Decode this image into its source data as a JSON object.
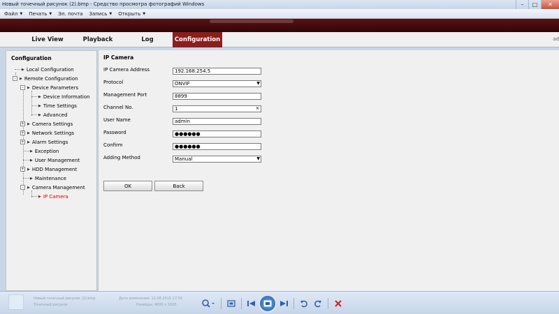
{
  "window": {
    "title": "Новый точечный рисунок (2).bmp - Средство просмотра фотографий Windows",
    "minimize_glyph": "–",
    "maximize_glyph": "□",
    "close_glyph": "✕"
  },
  "menu": {
    "items": [
      {
        "label": "Файл"
      },
      {
        "label": "Печать"
      },
      {
        "label": "Эл. почта"
      },
      {
        "label": "Запись"
      },
      {
        "label": "Открыть"
      }
    ]
  },
  "nav": {
    "tabs": [
      {
        "label": "Live View"
      },
      {
        "label": "Playback"
      },
      {
        "label": "Log"
      },
      {
        "label": "Configuration"
      }
    ],
    "active_tab": "Configuration",
    "user_label": "ad"
  },
  "sidebar": {
    "title": "Configuration",
    "items": [
      {
        "label": "Local Configuration",
        "expander": ""
      },
      {
        "label": "Remote Configuration",
        "expander": "–"
      },
      {
        "label": "Device Parameters",
        "expander": "–"
      },
      {
        "label": "Device Information",
        "expander": ""
      },
      {
        "label": "Time Settings",
        "expander": ""
      },
      {
        "label": "Advanced",
        "expander": ""
      },
      {
        "label": "Camera Settings",
        "expander": "+"
      },
      {
        "label": "Network Settings",
        "expander": "+"
      },
      {
        "label": "Alarm Settings",
        "expander": "+"
      },
      {
        "label": "Exception",
        "expander": ""
      },
      {
        "label": "User Management",
        "expander": ""
      },
      {
        "label": "HDD Management",
        "expander": "+"
      },
      {
        "label": "Maintenance",
        "expander": ""
      },
      {
        "label": "Camera Management",
        "expander": "–"
      },
      {
        "label": "IP Camera",
        "expander": "",
        "selected": true
      }
    ]
  },
  "form": {
    "title": "IP Camera",
    "fields": [
      {
        "label": "IP Camera Address",
        "value": "192.168.254.5"
      },
      {
        "label": "Protocol",
        "value": "ONVIF"
      },
      {
        "label": "Management Port",
        "value": "8899"
      },
      {
        "label": "Channel No.",
        "value": "1"
      },
      {
        "label": "User Name",
        "value": "admin"
      },
      {
        "label": "Password",
        "value": "●●●●●●"
      },
      {
        "label": "Confirm",
        "value": "●●●●●●"
      },
      {
        "label": "Adding Method",
        "value": "Manual"
      }
    ],
    "ok_label": "OK",
    "back_label": "Back"
  },
  "viewer": {
    "faded_name": "Новый точечный рисунок (2).bmp",
    "faded_type": "Точечный рисунок",
    "faded_date": "Дата изменения: 12.08.2015 17:50",
    "faded_size": "Размеры: 4000 x 1600",
    "icons": [
      "zoom-icon",
      "fit-window-icon",
      "previous-icon",
      "slideshow-icon",
      "next-icon",
      "rotate-left-icon",
      "rotate-right-icon",
      "delete-icon"
    ]
  },
  "colors": {
    "header_red": "#5b1010",
    "active_tab": "#8b1e1e",
    "selected_text": "#d40000"
  }
}
